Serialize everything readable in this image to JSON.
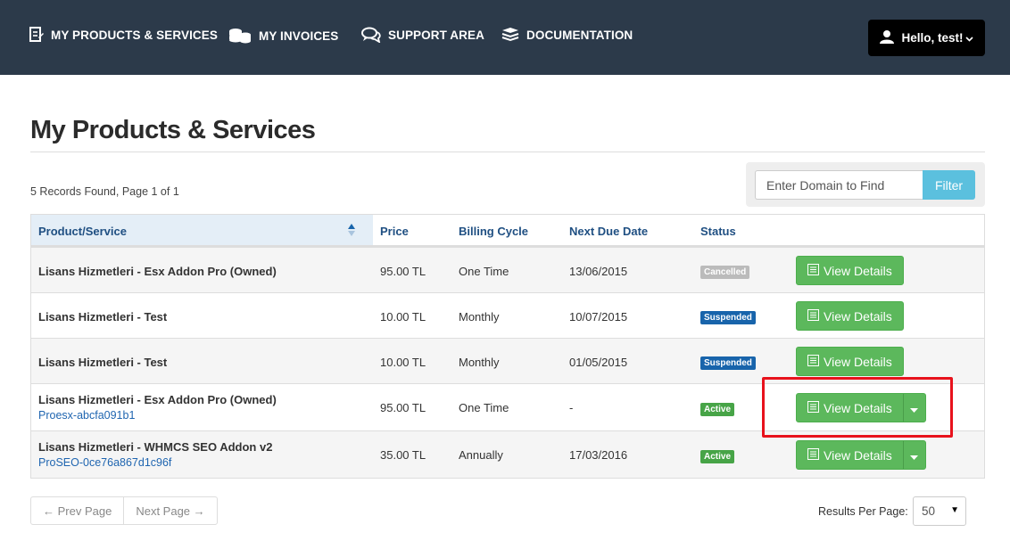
{
  "nav": {
    "products": "MY PRODUCTS & SERVICES",
    "invoices": "MY INVOICES",
    "support": "SUPPORT AREA",
    "docs": "DOCUMENTATION",
    "user": "Hello, test!"
  },
  "page": {
    "title": "My Products & Services",
    "records": "5 Records Found, Page 1 of 1"
  },
  "filter": {
    "placeholder": "Enter Domain to Find",
    "button": "Filter"
  },
  "table": {
    "headers": [
      "Product/Service",
      "Price",
      "Billing Cycle",
      "Next Due Date",
      "Status"
    ],
    "rows": [
      {
        "product": "Lisans Hizmetleri - Esx Addon Pro (Owned)",
        "domain": "",
        "price": "95.00 TL",
        "cycle": "One Time",
        "due": "13/06/2015",
        "status": "Cancelled"
      },
      {
        "product": "Lisans Hizmetleri - Test",
        "domain": "",
        "price": "10.00 TL",
        "cycle": "Monthly",
        "due": "10/07/2015",
        "status": "Suspended"
      },
      {
        "product": "Lisans Hizmetleri - Test",
        "domain": "",
        "price": "10.00 TL",
        "cycle": "Monthly",
        "due": "01/05/2015",
        "status": "Suspended"
      },
      {
        "product": "Lisans Hizmetleri - Esx Addon Pro (Owned)",
        "domain": "Proesx-abcfa091b1",
        "price": "95.00 TL",
        "cycle": "One Time",
        "due": "-",
        "status": "Active"
      },
      {
        "product": "Lisans Hizmetleri - WHMCS SEO Addon v2",
        "domain": "ProSEO-0ce76a867d1c96f",
        "price": "35.00 TL",
        "cycle": "Annually",
        "due": "17/03/2016",
        "status": "Active"
      }
    ],
    "action_label": "View Details"
  },
  "pager": {
    "prev": "← Prev Page",
    "next": "Next Page →",
    "rpp_label": "Results Per Page:",
    "rpp_value": "50"
  },
  "colors": {
    "nav_bg": "#2c3a4a",
    "action_green": "#5cb85c",
    "filter_blue": "#5bc0de",
    "highlight_red": "#e8121c"
  }
}
